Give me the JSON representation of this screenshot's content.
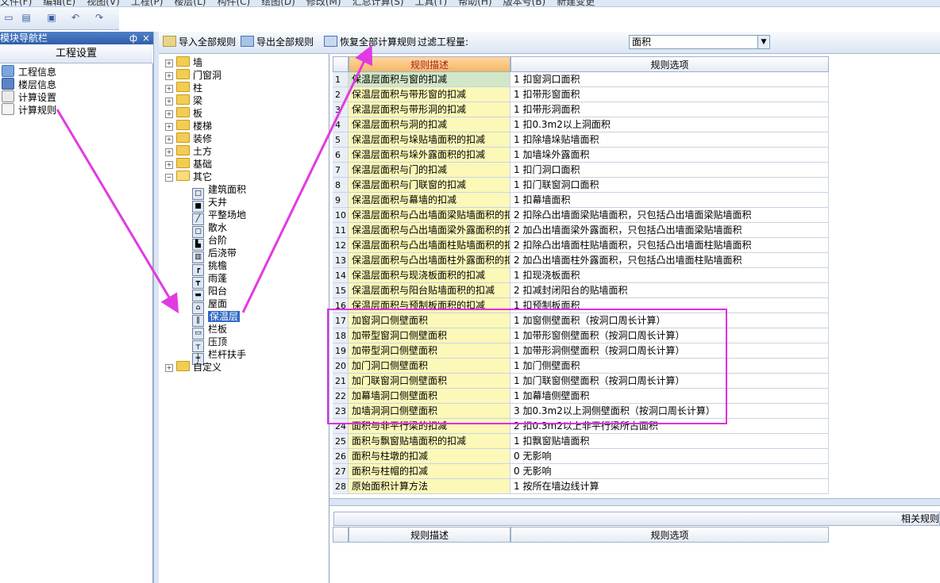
{
  "menubar": {
    "items": [
      "文件(F)",
      "编辑(E)",
      "视图(V)",
      "工程(P)",
      "楼层(L)",
      "构件(C)",
      "绘图(D)",
      "修改(M)",
      "汇总计算(S)",
      "工具(T)",
      "帮助(H)",
      "版本号(B)",
      "新建变更"
    ]
  },
  "nav": {
    "title": "模块导航栏",
    "pin": "ф",
    "close": "×",
    "section": "工程设置",
    "items": [
      {
        "label": "工程信息",
        "icon": "project-info-icon"
      },
      {
        "label": "楼层信息",
        "icon": "floor-info-icon"
      },
      {
        "label": "计算设置",
        "icon": "calc-settings-icon"
      },
      {
        "label": "计算规则",
        "icon": "calc-rules-icon"
      }
    ]
  },
  "toolbar": {
    "import_all": "导入全部规则",
    "export_all": "导出全部规则",
    "restore_all": "恢复全部计算规则",
    "filter_label": "过滤工程量:",
    "filter_value": "面积"
  },
  "tree": {
    "items": [
      {
        "label": "墙",
        "expanded": false
      },
      {
        "label": "门窗洞",
        "expanded": false
      },
      {
        "label": "柱",
        "expanded": false
      },
      {
        "label": "梁",
        "expanded": false
      },
      {
        "label": "板",
        "expanded": false
      },
      {
        "label": "楼梯",
        "expanded": false
      },
      {
        "label": "装修",
        "expanded": false
      },
      {
        "label": "土方",
        "expanded": false
      },
      {
        "label": "基础",
        "expanded": false
      },
      {
        "label": "其它",
        "expanded": true
      }
    ],
    "children": [
      "建筑面积",
      "天井",
      "平整场地",
      "散水",
      "台阶",
      "后浇带",
      "挑檐",
      "雨蓬",
      "阳台",
      "屋面",
      "保温层",
      "栏板",
      "压顶",
      "栏杆扶手"
    ],
    "selected": "保温层",
    "last": "自定义"
  },
  "grid": {
    "headers": [
      "规则描述",
      "规则选项"
    ],
    "rows": [
      {
        "num": "1",
        "desc": "保温层面积与窗的扣减",
        "opt": "1 扣窗洞口面积"
      },
      {
        "num": "2",
        "desc": "保温层面积与带形窗的扣减",
        "opt": "1 扣带形窗面积"
      },
      {
        "num": "3",
        "desc": "保温层面积与带形洞的扣减",
        "opt": "1 扣带形洞面积"
      },
      {
        "num": "4",
        "desc": "保温层面积与洞的扣减",
        "opt": "1 扣0.3m2以上洞面积"
      },
      {
        "num": "5",
        "desc": "保温层面积与垛贴墙面积的扣减",
        "opt": "1 扣除墙垛贴墙面积"
      },
      {
        "num": "6",
        "desc": "保温层面积与垛外露面积的扣减",
        "opt": "1 加墙垛外露面积"
      },
      {
        "num": "7",
        "desc": "保温层面积与门的扣减",
        "opt": "1 扣门洞口面积"
      },
      {
        "num": "8",
        "desc": "保温层面积与门联窗的扣减",
        "opt": "1 扣门联窗洞口面积"
      },
      {
        "num": "9",
        "desc": "保温层面积与幕墙的扣减",
        "opt": "1 扣幕墙面积"
      },
      {
        "num": "10",
        "desc": "保温层面积与凸出墙面梁贴墙面积的扣减",
        "opt": "2 扣除凸出墙面梁贴墙面积，只包括凸出墙面梁贴墙面积"
      },
      {
        "num": "11",
        "desc": "保温层面积与凸出墙面梁外露面积的扣减",
        "opt": "2 加凸出墙面梁外露面积，只包括凸出墙面梁贴墙面积"
      },
      {
        "num": "12",
        "desc": "保温层面积与凸出墙面柱贴墙面积的扣减",
        "opt": "2 扣除凸出墙面柱贴墙面积，只包括凸出墙面柱贴墙面积"
      },
      {
        "num": "13",
        "desc": "保温层面积与凸出墙面柱外露面积的扣减",
        "opt": "2 加凸出墙面柱外露面积，只包括凸出墙面柱贴墙面积"
      },
      {
        "num": "14",
        "desc": "保温层面积与现浇板面积的扣减",
        "opt": "1 扣现浇板面积"
      },
      {
        "num": "15",
        "desc": "保温层面积与阳台贴墙面积的扣减",
        "opt": "2 扣减封闭阳台的贴墙面积"
      },
      {
        "num": "16",
        "desc": "保温层面积与预制板面积的扣减",
        "opt": "1 扣预制板面积"
      },
      {
        "num": "17",
        "desc": "加窗洞口侧壁面积",
        "opt": "1 加窗侧壁面积（按洞口周长计算）"
      },
      {
        "num": "18",
        "desc": "加带型窗洞口侧壁面积",
        "opt": "1 加带形窗侧壁面积（按洞口周长计算）"
      },
      {
        "num": "19",
        "desc": "加带型洞口侧壁面积",
        "opt": "1 加带形洞侧壁面积（按洞口周长计算）"
      },
      {
        "num": "20",
        "desc": "加门洞口侧壁面积",
        "opt": "1 加门侧壁面积"
      },
      {
        "num": "21",
        "desc": "加门联窗洞口侧壁面积",
        "opt": "1 加门联窗侧壁面积（按洞口周长计算）"
      },
      {
        "num": "22",
        "desc": "加幕墙洞口侧壁面积",
        "opt": "1 加幕墙侧壁面积"
      },
      {
        "num": "23",
        "desc": "加墙洞洞口侧壁面积",
        "opt": "3 加0.3m2以上洞侧壁面积（按洞口周长计算）"
      },
      {
        "num": "24",
        "desc": "面积与非平行梁的扣减",
        "opt": "2 扣0.3m2以上非平行梁所占面积"
      },
      {
        "num": "25",
        "desc": "面积与飘窗贴墙面积的扣减",
        "opt": "1 扣飘窗贴墙面积"
      },
      {
        "num": "26",
        "desc": "面积与柱墩的扣减",
        "opt": "0  无影响"
      },
      {
        "num": "27",
        "desc": "面积与柱帽的扣减",
        "opt": "0  无影响"
      },
      {
        "num": "28",
        "desc": "原始面积计算方法",
        "opt": "1 按所在墙边线计算"
      }
    ]
  },
  "related": {
    "label": "相关规则"
  },
  "lower_grid": {
    "headers": [
      "规则描述",
      "规则选项"
    ]
  },
  "colors": {
    "highlight": "#e02ee0",
    "arrow": "#e23ae2",
    "desc_bg": "#fbf8b8",
    "selected": "#3168c4"
  }
}
